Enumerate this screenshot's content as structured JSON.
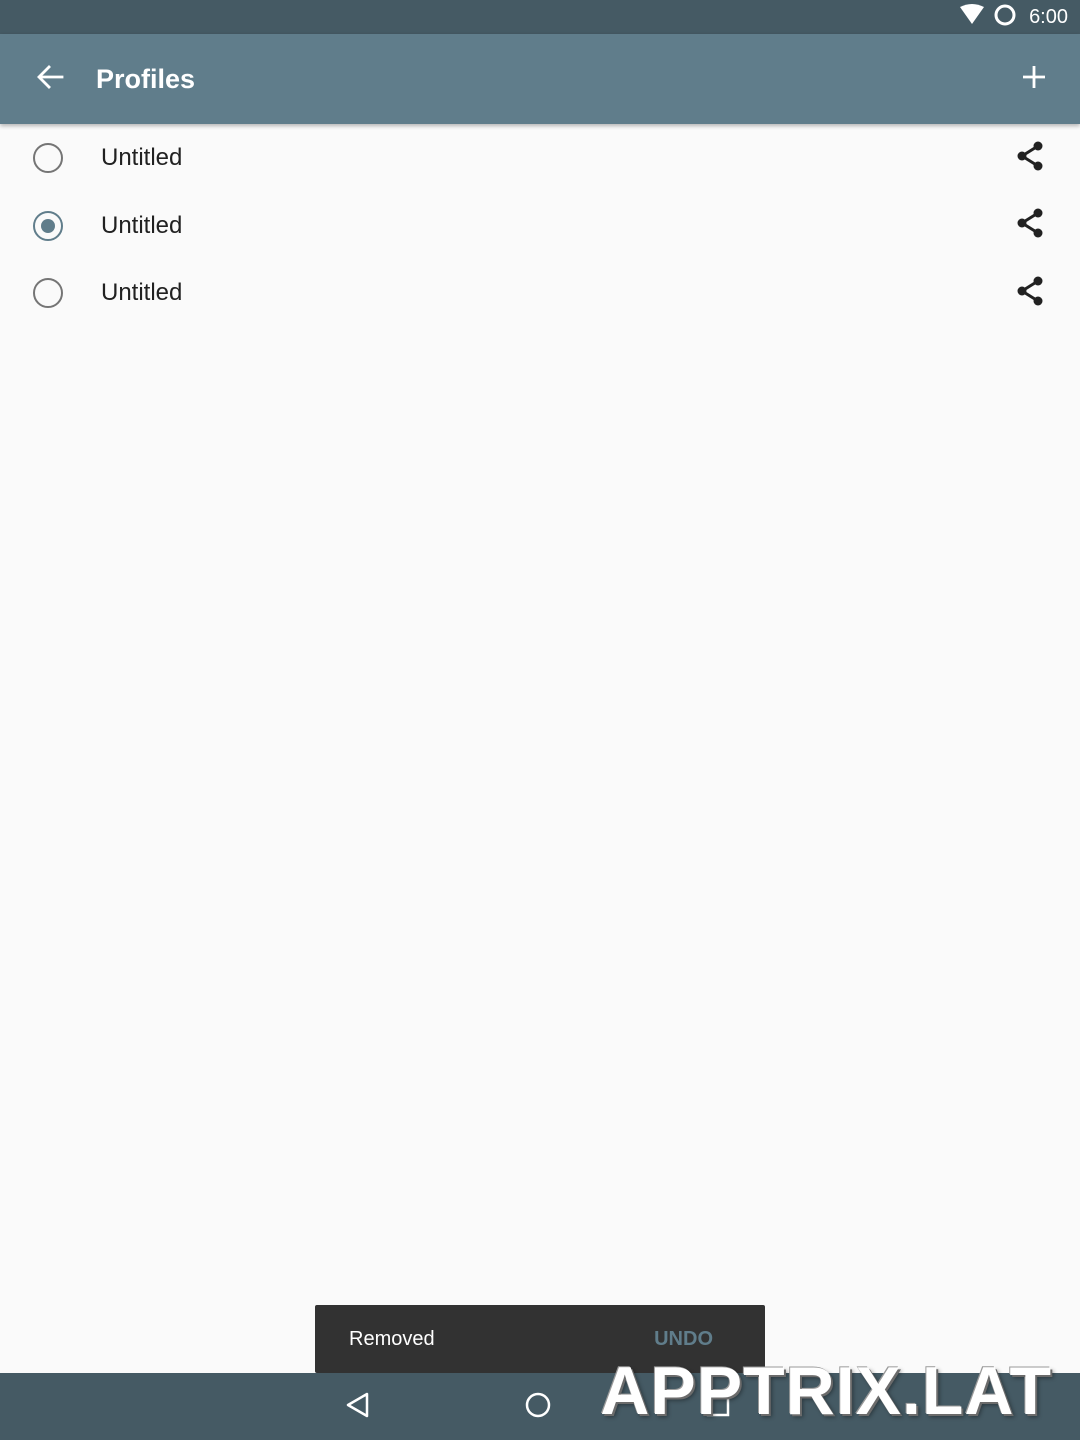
{
  "status_bar": {
    "time": "6:00",
    "icons": [
      "wifi-icon",
      "status-circle-icon"
    ]
  },
  "app_bar": {
    "title": "Profiles",
    "back_icon": "arrow-back-icon",
    "add_icon": "plus-icon"
  },
  "profiles": [
    {
      "name": "Untitled",
      "selected": false,
      "share_icon": "share-icon"
    },
    {
      "name": "Untitled",
      "selected": true,
      "share_icon": "share-icon"
    },
    {
      "name": "Untitled",
      "selected": false,
      "share_icon": "share-icon"
    }
  ],
  "snackbar": {
    "message": "Removed",
    "action": "UNDO"
  },
  "nav_bar": {
    "icons": [
      "back-triangle-icon",
      "home-circle-icon",
      "recents-square-icon"
    ]
  },
  "watermark": "APPTRIX.LAT",
  "colors": {
    "status_bar": "#455a64",
    "app_bar": "#607d8b",
    "accent": "#607d8b",
    "background": "#fafafa",
    "snackbar": "#323232",
    "nav_bar": "#455a64"
  }
}
